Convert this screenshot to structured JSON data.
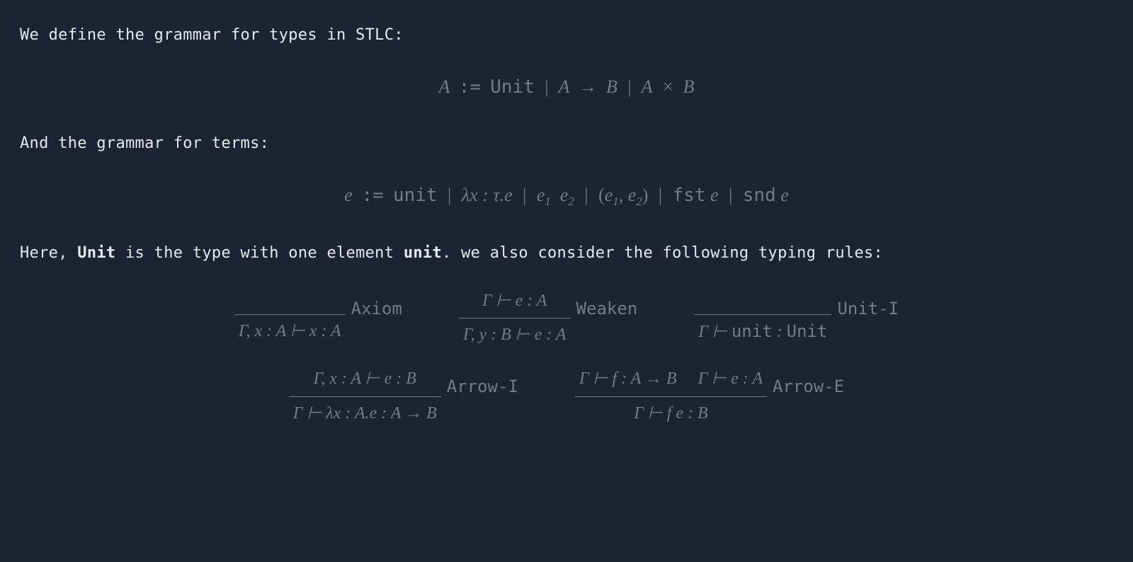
{
  "para1": "We define the grammar for types in STLC:",
  "types_grammar": {
    "lhs": "A",
    "op": ":=",
    "rhs_unit": "Unit",
    "rhs_arrow_l": "A",
    "rhs_arrow_sym": "→",
    "rhs_arrow_r": "B",
    "rhs_prod_l": "A",
    "rhs_prod_sym": "×",
    "rhs_prod_r": "B"
  },
  "para2": "And the grammar for terms:",
  "terms_grammar": {
    "lhs": "e",
    "op": ":=",
    "unit": "unit",
    "lam_prefix": "λx : τ.e",
    "app_e1": "e",
    "app_e1_sub": "1",
    "app_e2": "e",
    "app_e2_sub": "2",
    "pair_open": "(",
    "pair_e1": "e",
    "pair_e1_sub": "1",
    "pair_comma": ",",
    "pair_e2": "e",
    "pair_e2_sub": "2",
    "pair_close": ")",
    "fst": "fst",
    "fst_arg": "e",
    "snd": "snd",
    "snd_arg": "e"
  },
  "para3_pre": "Here, ",
  "para3_unit_type": "Unit",
  "para3_mid": " is the type with one element ",
  "para3_unit_term": "unit",
  "para3_post": ". we also consider the following typing rules:",
  "rules": {
    "axiom": {
      "premise": "",
      "concl": "Γ, x : A ⊢ x : A",
      "label": "Axiom"
    },
    "weaken": {
      "premise": "Γ ⊢ e : A",
      "concl": "Γ, y : B ⊢ e : A",
      "label": "Weaken"
    },
    "unit_i": {
      "premise": "",
      "concl_ctx": "Γ ⊢ ",
      "concl_term": "unit",
      "concl_mid": " : ",
      "concl_type": "Unit",
      "label": "Unit-I"
    },
    "arrow_i": {
      "premise": "Γ, x : A ⊢ e : B",
      "concl": "Γ ⊢ λx : A.e : A → B",
      "label": "Arrow-I"
    },
    "arrow_e": {
      "premise1": "Γ ⊢ f : A → B",
      "premise2": "Γ ⊢ e : A",
      "concl": "Γ ⊢ f e : B",
      "label": "Arrow-E"
    }
  }
}
